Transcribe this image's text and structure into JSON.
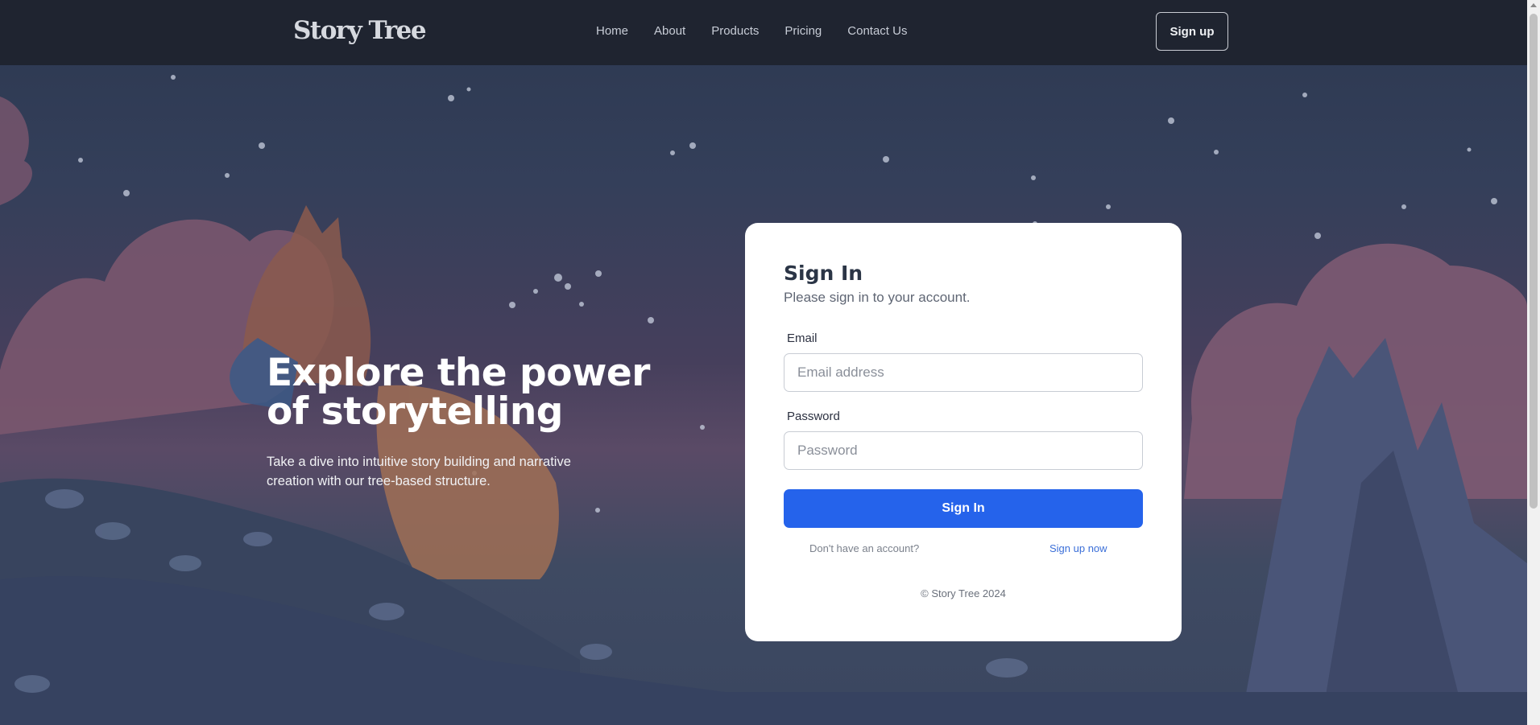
{
  "nav": {
    "logo": "Story Tree",
    "links": [
      "Home",
      "About",
      "Products",
      "Pricing",
      "Contact Us"
    ],
    "signup_label": "Sign up"
  },
  "hero": {
    "title": "Explore the power of storytelling",
    "subtitle": "Take a dive into intuitive story building and narrative creation with our tree-based structure."
  },
  "signin": {
    "title": "Sign In",
    "subtitle": "Please sign in to your account.",
    "email_label": "Email",
    "email_placeholder": "Email address",
    "password_label": "Password",
    "password_placeholder": "Password",
    "submit_label": "Sign In",
    "no_account_text": "Don't have an account?",
    "signup_link": "Sign up now",
    "copyright": "© Story Tree 2024"
  },
  "colors": {
    "navbar_bg": "#1f2430",
    "primary": "#2563eb",
    "link": "#3b6fd8",
    "card_bg": "#ffffff"
  }
}
